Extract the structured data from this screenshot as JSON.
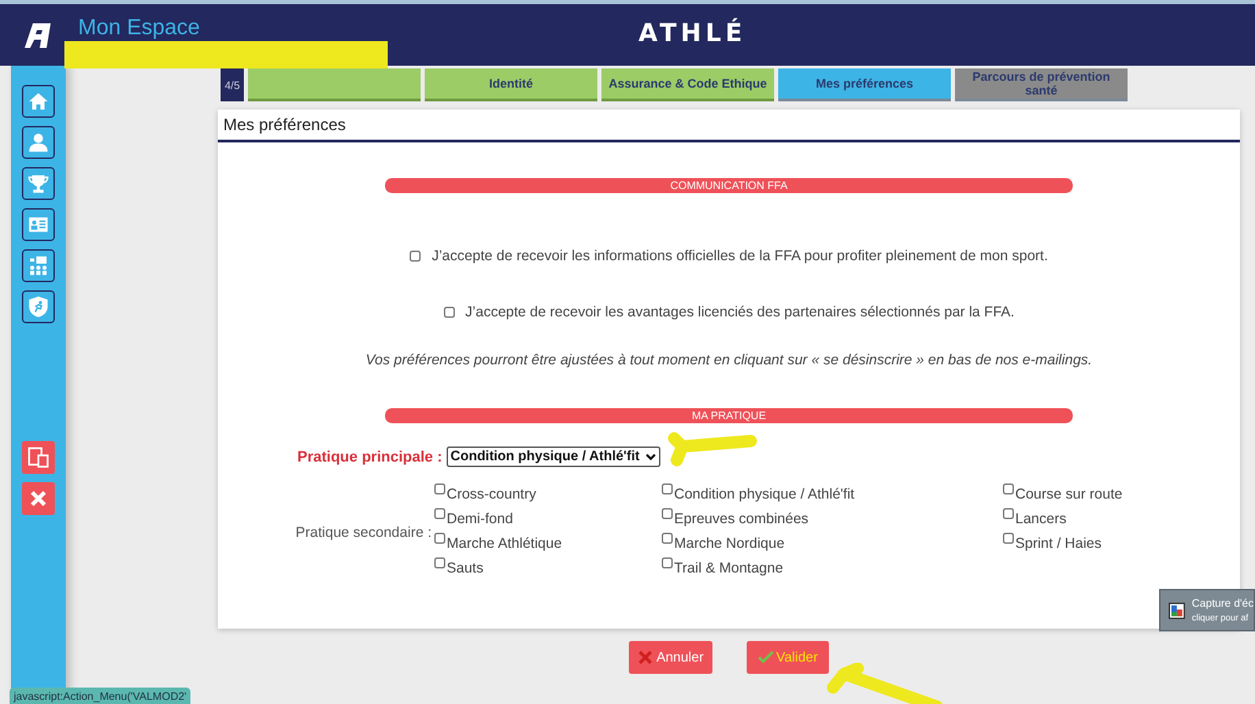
{
  "header": {
    "title": "Mon Espace",
    "brand": "ATHLÉ"
  },
  "sidebar": {
    "items": [
      {
        "kind": "home"
      },
      {
        "kind": "user"
      },
      {
        "kind": "trophy"
      },
      {
        "kind": "card"
      },
      {
        "kind": "board"
      },
      {
        "kind": "shield"
      }
    ],
    "actions": [
      {
        "kind": "devices"
      },
      {
        "kind": "close"
      }
    ]
  },
  "steps": {
    "counter": "4/5",
    "tabs": [
      {
        "completed": true,
        "selected": false
      },
      {
        "label": "Identité",
        "completed": true,
        "selected": false
      },
      {
        "label": "Assurance & Code Ethique",
        "completed": true,
        "selected": false
      },
      {
        "label": "Mes préférences",
        "completed": false,
        "selected": true
      },
      {
        "label": "Parcours de prévention santé",
        "completed": false,
        "selected": false
      }
    ]
  },
  "panel": {
    "title": "Mes préférences",
    "communication": {
      "heading": "COMMUNICATION FFA",
      "consents": [
        {
          "label": "J’accepte de recevoir les informations officielles de la FFA pour profiter pleinement de mon sport.",
          "checked": false
        },
        {
          "label": "J’accepte de recevoir les avantages licenciés des partenaires sélectionnés par la FFA.",
          "checked": false
        }
      ],
      "note": "Vos préférences pourront être ajustées à tout moment en cliquant sur « se désinscrire » en bas de nos e-mailings."
    },
    "practice": {
      "heading": "MA PRATIQUE",
      "main_label": "Pratique principale :",
      "main_value": "Condition physique / Athlé'fit",
      "secondary_label": "Pratique secondaire :",
      "secondary": [
        {
          "label": "Cross-country",
          "checked": false
        },
        {
          "label": "Condition physique / Athlé'fit",
          "checked": false
        },
        {
          "label": "Course sur route",
          "checked": false
        },
        {
          "label": "Demi-fond",
          "checked": false
        },
        {
          "label": "Epreuves combinées",
          "checked": false
        },
        {
          "label": "Lancers",
          "checked": false
        },
        {
          "label": "Marche Athlétique",
          "checked": false
        },
        {
          "label": "Marche Nordique",
          "checked": false
        },
        {
          "label": "Sprint / Haies",
          "checked": false
        },
        {
          "label": "Sauts",
          "checked": false
        },
        {
          "label": "Trail & Montagne",
          "checked": false
        }
      ]
    }
  },
  "buttons": [
    {
      "kind": "cancel",
      "label": "Annuler"
    },
    {
      "kind": "submit",
      "label": "Valider"
    }
  ],
  "status_bar": "javascript:Action_Menu('VALMOD2'",
  "notification": {
    "title": "Capture d'éc",
    "subtitle": "cliquer pour af"
  },
  "annotations": [
    {
      "kind": "highlight"
    },
    {
      "kind": "arrow"
    },
    {
      "kind": "arrow"
    }
  ]
}
